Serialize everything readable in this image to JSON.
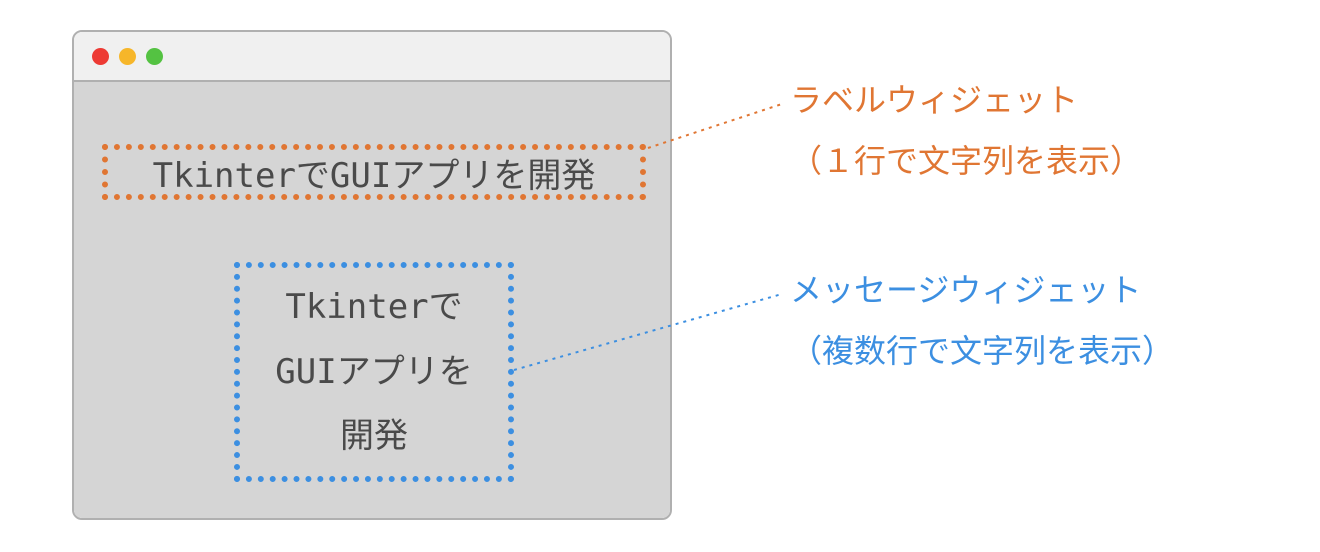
{
  "window": {
    "label_widget_text": "TkinterでGUIアプリを開発",
    "message_widget_line1": "Tkinterで",
    "message_widget_line2": "GUIアプリを",
    "message_widget_line3": "開発"
  },
  "annotations": {
    "label_title": "ラベルウィジェット",
    "label_desc": "（１行で文字列を表示）",
    "message_title": "メッセージウィジェット",
    "message_desc": "（複数行で文字列を表示）"
  },
  "colors": {
    "orange": "#e07633",
    "blue": "#3c8fe1",
    "red_light": "#ed3a34",
    "yellow_light": "#f6b62a",
    "green_light": "#54c242",
    "body_bg": "#d5d5d5",
    "titlebar_bg": "#f0f0f0",
    "text": "#4a4a4a"
  }
}
